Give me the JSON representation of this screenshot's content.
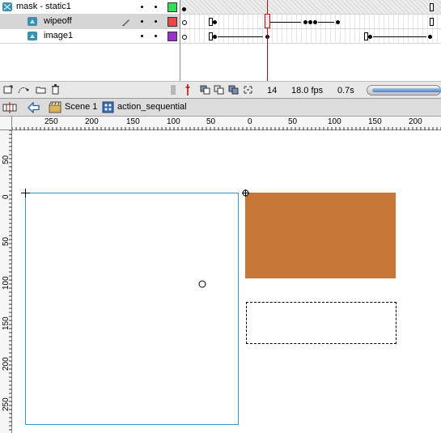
{
  "timeline": {
    "layers": [
      {
        "name": "mask - static1",
        "color": "#33dd55",
        "icon": "mask-layer-icon"
      },
      {
        "name": "wipeoff",
        "color": "#ee4444",
        "icon": "masked-layer-icon",
        "edit_icon": "pencil-icon",
        "selected": true
      },
      {
        "name": "image1",
        "color": "#9933cc",
        "icon": "masked-layer-icon"
      }
    ],
    "status": {
      "current_frame": "14",
      "fps": "18.0 fps",
      "elapsed": "0.7s"
    }
  },
  "editbar": {
    "scene": "Scene 1",
    "symbol": "action_sequential"
  },
  "rulers": {
    "horizontal": [
      "250",
      "200",
      "150",
      "100",
      "50",
      "0",
      "50",
      "100",
      "150",
      "200"
    ],
    "vertical": [
      "50",
      "0",
      "50",
      "100",
      "150",
      "200",
      "250"
    ]
  },
  "stage": {
    "fill_color": "#c87538",
    "outline_color": "#3399cc"
  }
}
